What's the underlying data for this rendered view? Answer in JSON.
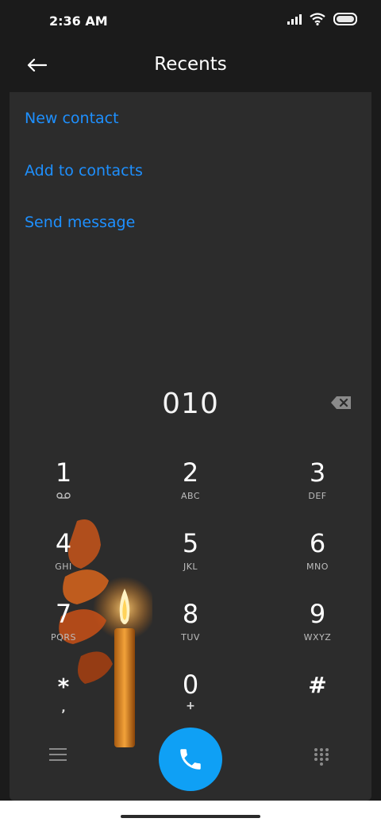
{
  "status_bar": {
    "time": "2:36 AM"
  },
  "header": {
    "title": "Recents",
    "back_icon": "arrow-left-icon"
  },
  "actions": [
    "New contact",
    "Add to contacts",
    "Send message"
  ],
  "dialer": {
    "number": "010",
    "keys": [
      {
        "digit": "1",
        "letters": ""
      },
      {
        "digit": "2",
        "letters": "ABC"
      },
      {
        "digit": "3",
        "letters": "DEF"
      },
      {
        "digit": "4",
        "letters": "GHI"
      },
      {
        "digit": "5",
        "letters": "JKL"
      },
      {
        "digit": "6",
        "letters": "MNO"
      },
      {
        "digit": "7",
        "letters": "PQRS"
      },
      {
        "digit": "8",
        "letters": "TUV"
      },
      {
        "digit": "9",
        "letters": "WXYZ"
      },
      {
        "digit": "*",
        "letters": ","
      },
      {
        "digit": "0",
        "letters": "+"
      },
      {
        "digit": "#",
        "letters": ""
      }
    ]
  },
  "colors": {
    "accent": "#1e90ff",
    "call_button": "#0fa0f5",
    "card": "#2c2c2c",
    "background": "#1b1b1b"
  }
}
